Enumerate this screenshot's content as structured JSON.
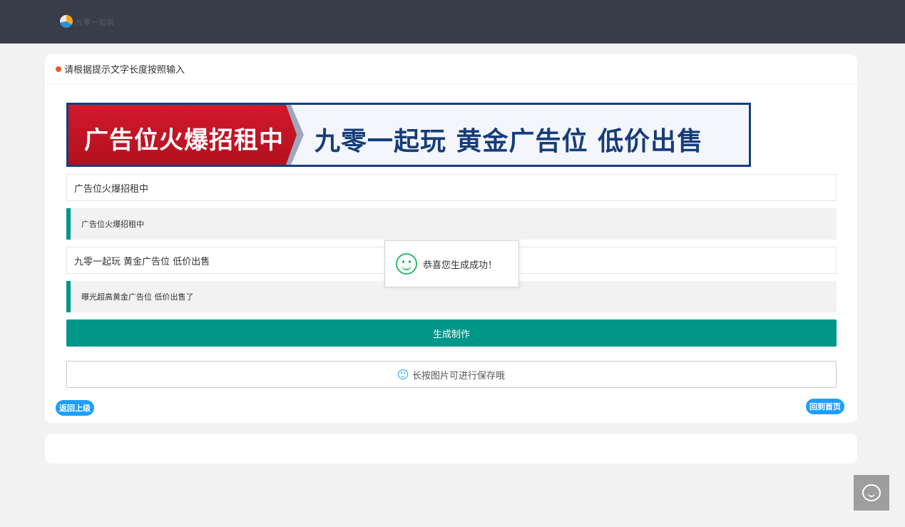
{
  "header": {
    "logo_icon": "logo-icon",
    "logo_text": "九零一起玩"
  },
  "form": {
    "title": "请根据提示文字长度按照输入",
    "banner": {
      "left_text": "广告位火爆招租中",
      "right_text": "九零一起玩 黄金广告位 低价出售"
    },
    "field1_value": "广告位火爆招租中",
    "hint1": "广告位火爆招租中",
    "field2_value": "九零一起玩 黄金广告位 低价出售",
    "hint2": "曝光超高黄金广告位  低价出售了",
    "generate_label": "生成制作",
    "save_label": "长按图片可进行保存哦",
    "back_label": "返回上级",
    "home_label": "回到首页"
  },
  "toast": {
    "icon": "smile-icon",
    "message": "恭喜您生成成功！"
  },
  "chat": {
    "icon": "chat-icon"
  },
  "colors": {
    "topbar": "#393d49",
    "accent": "#009688",
    "link_blue": "#1e9fff",
    "dot_orange": "#ef5b26",
    "success_green": "#2fbb6b"
  }
}
